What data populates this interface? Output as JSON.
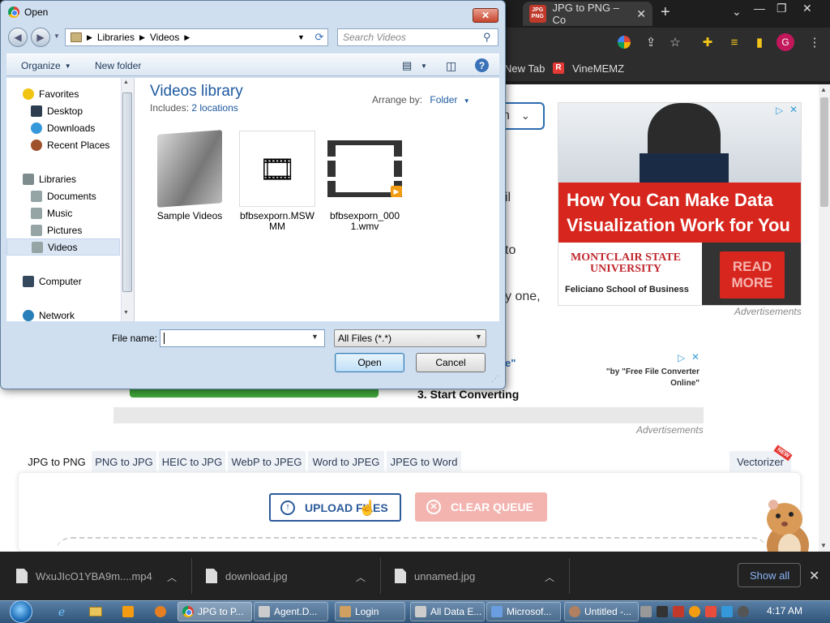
{
  "browser": {
    "active_tab_icon_text": "JPG PNG",
    "active_tab_title": "JPG to PNG – Co",
    "bookmarks": [
      "New Tab",
      "VineMEMZ"
    ],
    "profile_initial": "G"
  },
  "dialog": {
    "title": "Open",
    "breadcrumb": [
      "Libraries",
      "Videos"
    ],
    "search_placeholder": "Search Videos",
    "organize_label": "Organize",
    "new_folder_label": "New folder",
    "nav": [
      {
        "label": "Favorites",
        "group": true
      },
      {
        "label": "Desktop"
      },
      {
        "label": "Downloads"
      },
      {
        "label": "Recent Places"
      },
      {
        "label": "Libraries",
        "group": true
      },
      {
        "label": "Documents"
      },
      {
        "label": "Music"
      },
      {
        "label": "Pictures"
      },
      {
        "label": "Videos",
        "selected": true
      },
      {
        "label": "Computer",
        "group": true
      },
      {
        "label": "Network",
        "group": true
      }
    ],
    "library_title": "Videos library",
    "includes_label": "Includes:",
    "includes_link": "2 locations",
    "arrange_by_label": "Arrange by:",
    "arrange_by_value": "Folder",
    "files": [
      {
        "name": "Sample Videos",
        "type": "folder"
      },
      {
        "name": "bfbsexporn.MSWMM",
        "type": "msw"
      },
      {
        "name": "bfbsexporn_0001.wmv",
        "type": "wmv"
      }
    ],
    "file_name_label": "File name:",
    "file_name_value": "",
    "filter_value": "All Files (*.*)",
    "open_label": "Open",
    "cancel_label": "Cancel"
  },
  "page": {
    "select_fragment": "n",
    "text_fragments": [
      "il",
      "to",
      "y one,",
      "e\""
    ],
    "ad": {
      "headline": "How You Can Make Data Visualization Work for You",
      "logo_text": "MONTCLAIR STATE UNIVERSITY",
      "school": "Feliciano School of Business",
      "cta": "READ MORE"
    },
    "ad_label_1": "Advertisements",
    "small_ad_text": "\"by \"Free File Converter Online\"",
    "step_title": "3. Start Converting",
    "ad_label_2": "Advertisements",
    "converter_tabs": [
      "JPG to PNG",
      "PNG to JPG",
      "HEIC to JPG",
      "WebP to JPEG",
      "Word to JPEG",
      "JPEG to Word"
    ],
    "vectorizer_label": "Vectorizer",
    "new_badge": "NEW",
    "upload_label": "UPLOAD FILES",
    "clear_label": "CLEAR QUEUE"
  },
  "downloads": {
    "items": [
      "WxuJIcO1YBA9m....mp4",
      "download.jpg",
      "unnamed.jpg"
    ],
    "show_all": "Show all"
  },
  "taskbar": {
    "tasks": [
      "JPG to P...",
      "Agent.D...",
      "Login",
      "All Data E...",
      "Microsof...",
      "Untitled -..."
    ],
    "clock": "4:17 AM"
  },
  "colors": {
    "accent_blue": "#2b5a9a",
    "ad_red": "#d7261e",
    "clear_btn": "#f3b4b0",
    "green_bar": "#3fa63a"
  }
}
